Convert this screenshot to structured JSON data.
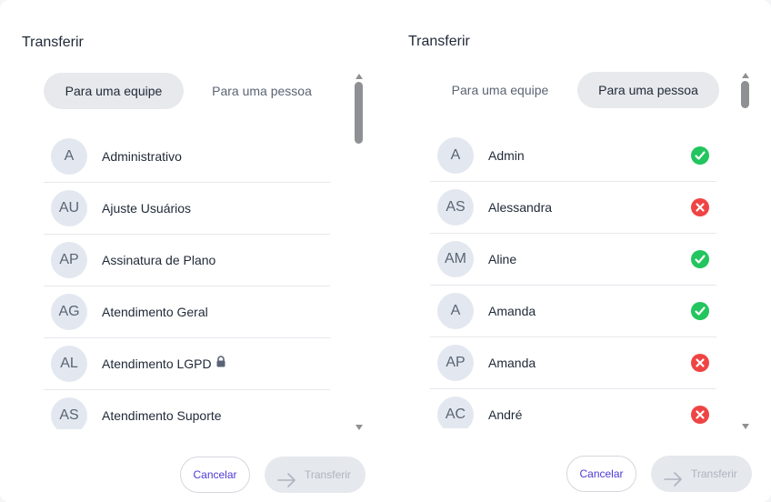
{
  "left": {
    "title": "Transferir",
    "tabs": [
      {
        "label": "Para uma equipe",
        "active": true
      },
      {
        "label": "Para uma pessoa",
        "active": false
      }
    ],
    "items": [
      {
        "initials": "A",
        "name": "Administrativo"
      },
      {
        "initials": "AU",
        "name": "Ajuste Usuários"
      },
      {
        "initials": "AP",
        "name": "Assinatura de Plano"
      },
      {
        "initials": "AG",
        "name": "Atendimento Geral"
      },
      {
        "initials": "AL",
        "name": "Atendimento LGPD",
        "icon": "lock-icon"
      },
      {
        "initials": "AS",
        "name": "Atendimento Suporte"
      }
    ],
    "cancel_label": "Cancelar",
    "transfer_label": "Transferir"
  },
  "right": {
    "title": "Transferir",
    "tabs": [
      {
        "label": "Para uma equipe",
        "active": false
      },
      {
        "label": "Para uma pessoa",
        "active": true
      }
    ],
    "items": [
      {
        "initials": "A",
        "name": "Admin",
        "status": "online"
      },
      {
        "initials": "AS",
        "name": "Alessandra",
        "status": "offline"
      },
      {
        "initials": "AM",
        "name": "Aline",
        "status": "online"
      },
      {
        "initials": "A",
        "name": "Amanda",
        "status": "online"
      },
      {
        "initials": "AP",
        "name": "Amanda",
        "status": "offline"
      },
      {
        "initials": "AC",
        "name": "André",
        "status": "offline"
      }
    ],
    "cancel_label": "Cancelar",
    "transfer_label": "Transferir"
  },
  "colors": {
    "online": "#22c55e",
    "offline": "#ef4444",
    "accent": "#4c3bd6"
  }
}
